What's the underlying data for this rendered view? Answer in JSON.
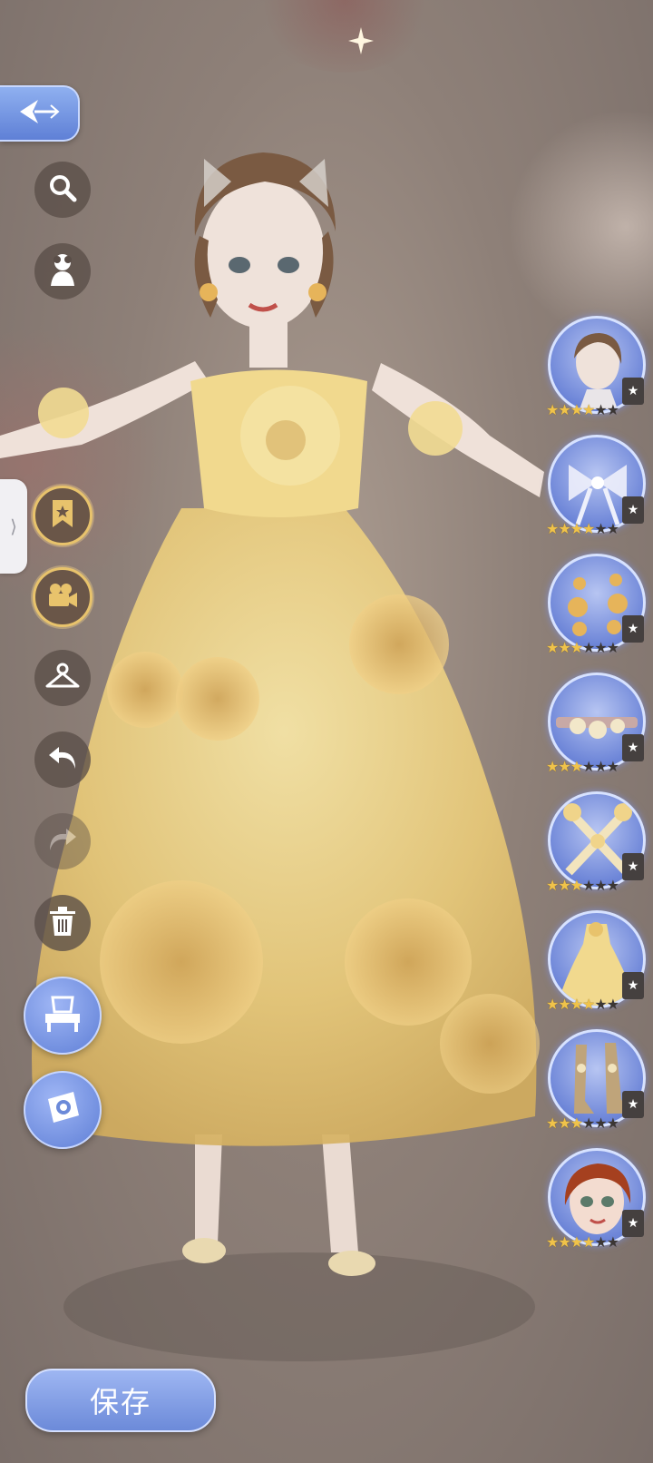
{
  "left_toolbar": {
    "back_icon": "back-arrow-icon",
    "search_icon": "search-icon",
    "bust_icon": "mannequin-bust-icon",
    "favorite_icon": "bookmark-star-icon",
    "camera_icon": "video-camera-icon",
    "hanger_icon": "hanger-icon",
    "undo_icon": "undo-icon",
    "redo_icon": "redo-icon",
    "trash_icon": "trash-icon",
    "dresser_icon": "vanity-dresser-icon",
    "photo_icon": "camera-icon"
  },
  "items": [
    {
      "slot": "hair",
      "stars_filled": 4,
      "stars_total": 6
    },
    {
      "slot": "headwear-bow",
      "stars_filled": 4,
      "stars_total": 6
    },
    {
      "slot": "earrings",
      "stars_filled": 3,
      "stars_total": 6
    },
    {
      "slot": "choker",
      "stars_filled": 3,
      "stars_total": 6
    },
    {
      "slot": "arm-accessories",
      "stars_filled": 3,
      "stars_total": 6
    },
    {
      "slot": "dress",
      "stars_filled": 4,
      "stars_total": 6
    },
    {
      "slot": "shoes",
      "stars_filled": 3,
      "stars_total": 6
    },
    {
      "slot": "face",
      "stars_filled": 4,
      "stars_total": 6
    }
  ],
  "save_label": "保存",
  "colors": {
    "accent_blue": "#6c8ad9",
    "gold": "#e8c36c",
    "star": "#f0c34a",
    "dress": "#f3d98a"
  }
}
